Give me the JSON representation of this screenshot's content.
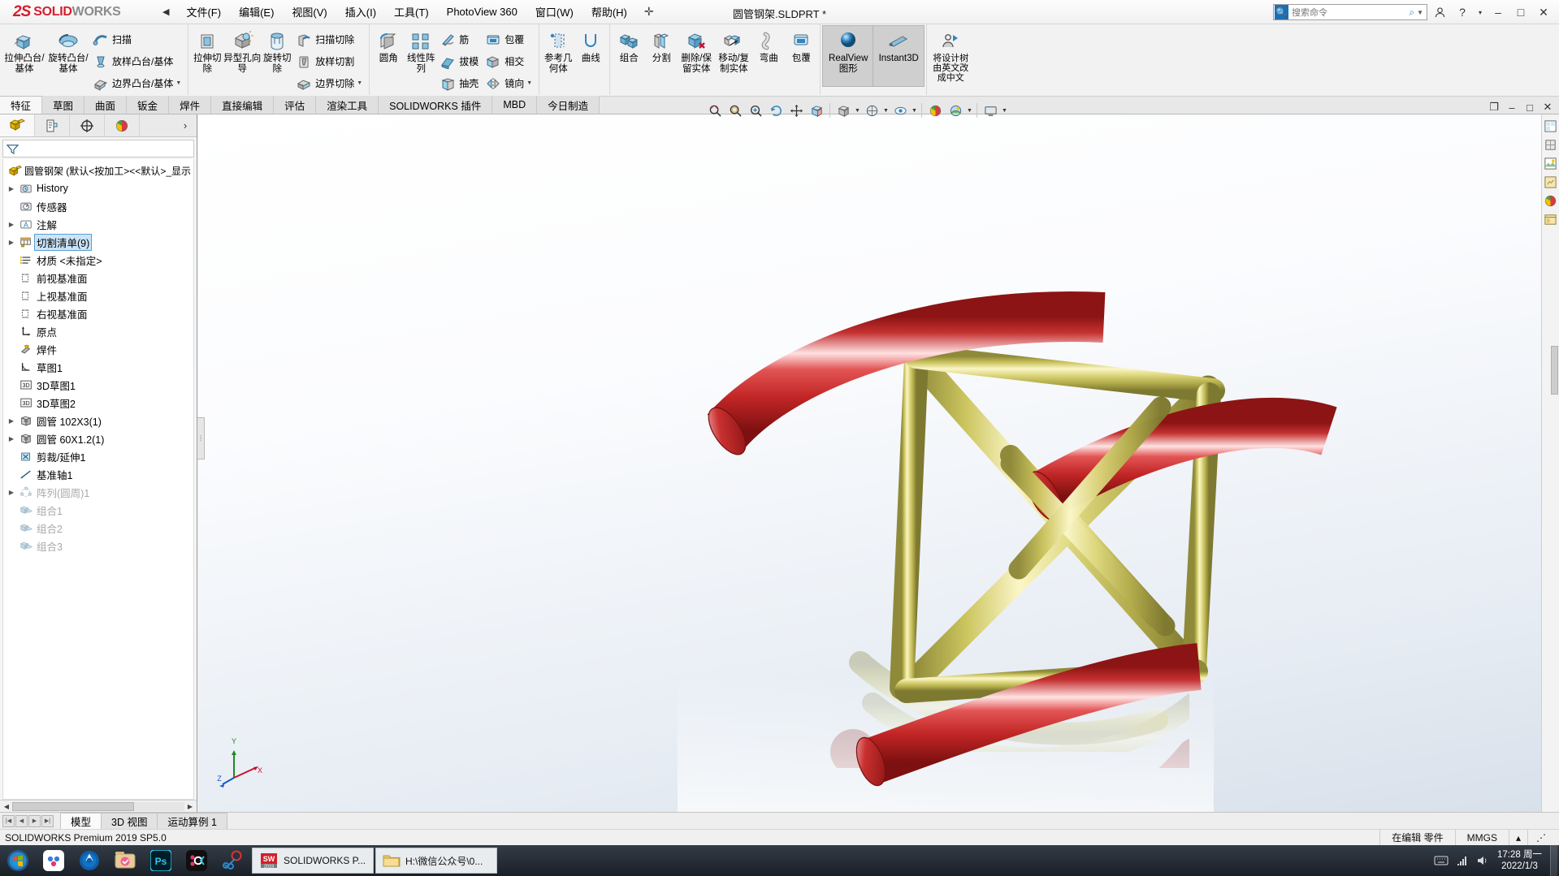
{
  "app": {
    "brand_ds": "2S",
    "brand_solid": "SOLID",
    "brand_works": "WORKS",
    "document_title": "圆管钢架.SLDPRT *",
    "accent_red": "#d61e2c",
    "selection_blue": "#cce4f7"
  },
  "menubar": {
    "items": [
      {
        "label": "文件(F)"
      },
      {
        "label": "编辑(E)"
      },
      {
        "label": "视图(V)"
      },
      {
        "label": "插入(I)"
      },
      {
        "label": "工具(T)"
      },
      {
        "label": "PhotoView 360"
      },
      {
        "label": "窗口(W)"
      },
      {
        "label": "帮助(H)"
      }
    ],
    "pin_icon": "pushpin-icon",
    "collapse_icon": "chevron-left-icon"
  },
  "search": {
    "placeholder": "搜索命令",
    "icon": "search-icon",
    "dropdown_icon": "chevron-down-icon"
  },
  "window_buttons": {
    "help": "?",
    "account": "user-icon",
    "minimize": "–",
    "maximize": "□",
    "close": "✕",
    "options_caret": "▾"
  },
  "ribbon": {
    "groups": [
      {
        "name": "features-boss",
        "big": [
          {
            "label": "拉伸凸台/基体",
            "icon": "extrude-boss-icon",
            "caret": true
          },
          {
            "label": "旋转凸台/基体",
            "icon": "revolve-boss-icon",
            "caret": true
          }
        ],
        "small": [
          {
            "label": "扫描",
            "icon": "sweep-icon"
          },
          {
            "label": "放样凸台/基体",
            "icon": "loft-icon"
          },
          {
            "label": "边界凸台/基体",
            "icon": "boundary-boss-icon"
          }
        ]
      },
      {
        "name": "features-cut",
        "big": [
          {
            "label": "拉伸切除",
            "icon": "extrude-cut-icon",
            "caret": true
          },
          {
            "label": "异型孔向导",
            "icon": "hole-wizard-icon",
            "caret": true
          },
          {
            "label": "旋转切除",
            "icon": "revolve-cut-icon"
          }
        ],
        "small": [
          {
            "label": "扫描切除",
            "icon": "sweep-cut-icon"
          },
          {
            "label": "放样切割",
            "icon": "loft-cut-icon"
          },
          {
            "label": "边界切除",
            "icon": "boundary-cut-icon"
          }
        ]
      },
      {
        "name": "features-modify",
        "big": [
          {
            "label": "圆角",
            "icon": "fillet-icon",
            "caret": true
          },
          {
            "label": "线性阵列",
            "icon": "linear-pattern-icon",
            "caret": true
          }
        ],
        "small": [
          {
            "label": "筋",
            "icon": "rib-icon"
          },
          {
            "label": "拔模",
            "icon": "draft-icon"
          },
          {
            "label": "抽壳",
            "icon": "shell-icon"
          }
        ],
        "small2": [
          {
            "label": "包覆",
            "icon": "wrap-icon"
          },
          {
            "label": "相交",
            "icon": "intersect-icon"
          },
          {
            "label": "镜向",
            "icon": "mirror-icon"
          }
        ]
      },
      {
        "name": "reference",
        "big": [
          {
            "label": "参考几何体",
            "icon": "reference-geometry-icon",
            "caret": true
          },
          {
            "label": "曲线",
            "icon": "curves-icon",
            "caret": true
          }
        ]
      },
      {
        "name": "bodies",
        "big": [
          {
            "label": "组合",
            "icon": "combine-icon"
          },
          {
            "label": "分割",
            "icon": "split-icon"
          },
          {
            "label": "删除/保留实体",
            "icon": "delete-keep-body-icon"
          },
          {
            "label": "移动/复制实体",
            "icon": "move-copy-body-icon"
          },
          {
            "label": "弯曲",
            "icon": "flex-icon"
          },
          {
            "label": "包覆",
            "icon": "wrap2-icon"
          }
        ]
      },
      {
        "name": "display",
        "big": [
          {
            "label": "RealView 图形",
            "icon": "realview-icon",
            "selected": true
          },
          {
            "label": "Instant3D",
            "icon": "instant3d-icon",
            "selected": true
          }
        ]
      },
      {
        "name": "translate",
        "big": [
          {
            "label": "将设计树由英文改成中文",
            "icon": "translate-tree-icon"
          }
        ]
      }
    ]
  },
  "command_tabs": {
    "items": [
      {
        "label": "特征",
        "active": true
      },
      {
        "label": "草图",
        "active": false
      },
      {
        "label": "曲面",
        "active": false
      },
      {
        "label": "钣金",
        "active": false
      },
      {
        "label": "焊件",
        "active": false
      },
      {
        "label": "直接编辑",
        "active": false
      },
      {
        "label": "评估",
        "active": false
      },
      {
        "label": "渲染工具",
        "active": false
      },
      {
        "label": "SOLIDWORKS 插件",
        "active": false
      },
      {
        "label": "MBD",
        "active": false
      },
      {
        "label": "今日制造",
        "active": false
      }
    ]
  },
  "view_toolbar": {
    "items": [
      {
        "icon": "zoom-to-fit-icon"
      },
      {
        "icon": "zoom-area-icon"
      },
      {
        "icon": "zoom-in-out-icon"
      },
      {
        "icon": "rotate-view-icon"
      },
      {
        "icon": "pan-icon"
      },
      {
        "icon": "section-view-icon"
      },
      {
        "icon": "view-orientation-icon",
        "caret": true
      },
      {
        "icon": "display-style-icon",
        "caret": true
      },
      {
        "icon": "hide-show-items-icon",
        "caret": true
      },
      {
        "icon": "edit-appearance-icon"
      },
      {
        "icon": "apply-scene-icon",
        "caret": true
      },
      {
        "icon": "view-settings-icon",
        "caret": true
      }
    ]
  },
  "doc_window_buttons": {
    "restore": "❐",
    "minimize": "–",
    "maximize": "□",
    "close": "✕"
  },
  "feature_manager": {
    "tabs": [
      {
        "name": "feature-manager-tab",
        "icon": "featuretree-icon",
        "active": true
      },
      {
        "name": "property-manager-tab",
        "icon": "property-manager-icon",
        "active": false
      },
      {
        "name": "configuration-manager-tab",
        "icon": "configuration-icon",
        "active": false
      },
      {
        "name": "display-manager-tab",
        "icon": "display-manager-icon",
        "active": false
      }
    ],
    "expand_icon": "chevron-right-icon",
    "filter_icon": "filter-icon",
    "filter_placeholder": "",
    "root": {
      "label": "圆管钢架  (默认<按加工><<默认>_显示",
      "icon": "part-icon"
    },
    "tree": [
      {
        "label": "History",
        "icon": "history-icon",
        "expandable": true,
        "indent": 1
      },
      {
        "label": "传感器",
        "icon": "sensors-icon",
        "expandable": false,
        "indent": 1
      },
      {
        "label": "注解",
        "icon": "annotations-icon",
        "expandable": true,
        "indent": 1
      },
      {
        "label": "切割清单(9)",
        "icon": "cutlist-icon",
        "expandable": true,
        "indent": 1,
        "selected": true
      },
      {
        "label": "材质 <未指定>",
        "icon": "material-icon",
        "expandable": false,
        "indent": 1
      },
      {
        "label": "前视基准面",
        "icon": "plane-icon",
        "expandable": false,
        "indent": 1
      },
      {
        "label": "上视基准面",
        "icon": "plane-icon",
        "expandable": false,
        "indent": 1
      },
      {
        "label": "右视基准面",
        "icon": "plane-icon",
        "expandable": false,
        "indent": 1
      },
      {
        "label": "原点",
        "icon": "origin-icon",
        "expandable": false,
        "indent": 1
      },
      {
        "label": "焊件",
        "icon": "weldment-icon",
        "expandable": false,
        "indent": 1
      },
      {
        "label": "草图1",
        "icon": "sketch-icon",
        "expandable": false,
        "indent": 1
      },
      {
        "label": "3D草图1",
        "icon": "sketch3d-icon",
        "expandable": false,
        "indent": 1
      },
      {
        "label": "3D草图2",
        "icon": "sketch3d-icon",
        "expandable": false,
        "indent": 1
      },
      {
        "label": "圆管 102X3(1)",
        "icon": "structural-member-icon",
        "expandable": true,
        "indent": 1
      },
      {
        "label": "圆管 60X1.2(1)",
        "icon": "structural-member-icon",
        "expandable": true,
        "indent": 1
      },
      {
        "label": "剪裁/延伸1",
        "icon": "trim-extend-icon",
        "expandable": false,
        "indent": 1
      },
      {
        "label": "基准轴1",
        "icon": "axis-icon",
        "expandable": false,
        "indent": 1
      },
      {
        "label": "阵列(圆周)1",
        "icon": "circular-pattern-icon",
        "expandable": true,
        "indent": 1,
        "dim": true
      },
      {
        "label": "组合1",
        "icon": "combine-tree-icon",
        "expandable": false,
        "indent": 1,
        "dim": true
      },
      {
        "label": "组合2",
        "icon": "combine-tree-icon",
        "expandable": false,
        "indent": 1,
        "dim": true
      },
      {
        "label": "组合3",
        "icon": "combine-tree-icon",
        "expandable": false,
        "indent": 1,
        "dim": true
      }
    ]
  },
  "graphics": {
    "triad_labels": {
      "x": "X",
      "y": "Y",
      "z": "Z"
    },
    "model_description": "圆管钢架 tubular steel frame - red 102X3 tubes and yellow 60X1.2 braces with reflection"
  },
  "right_rail": {
    "items": [
      {
        "icon": "view-palette-icon"
      },
      {
        "icon": "appearances-icon"
      },
      {
        "icon": "scenes-icon"
      },
      {
        "icon": "decals-icon"
      },
      {
        "icon": "custom-properties-icon"
      },
      {
        "icon": "design-library-icon"
      }
    ]
  },
  "bottom_tabs": {
    "nav": [
      "|◀",
      "◀",
      "▶",
      "▶|"
    ],
    "items": [
      {
        "label": "模型",
        "active": true
      },
      {
        "label": "3D 视图",
        "active": false
      },
      {
        "label": "运动算例 1",
        "active": false
      }
    ]
  },
  "status_bar": {
    "left": "SOLIDWORKS Premium 2019 SP5.0",
    "editing": "在编辑 零件",
    "units": "MMGS",
    "units_caret": "▴"
  },
  "taskbar": {
    "start_icon": "windows-start-icon",
    "pinned": [
      {
        "icon": "app-360-icon",
        "name": "cloud-app"
      },
      {
        "icon": "browser-icon",
        "name": "browser-app"
      },
      {
        "icon": "folder-photo-icon",
        "name": "photo-manager-app"
      },
      {
        "icon": "photoshop-icon",
        "name": "photoshop-app",
        "label": "Ps"
      },
      {
        "icon": "obs-icon",
        "name": "capture-app"
      },
      {
        "icon": "snip-icon",
        "name": "snipping-tool-app"
      }
    ],
    "windows": [
      {
        "label": "SOLIDWORKS P...",
        "icon": "solidworks-icon",
        "badge": "2019"
      },
      {
        "label": "H:\\微信公众号\\0...",
        "icon": "folder-icon"
      }
    ],
    "tray_icons": [
      "keyboard-icon",
      "network-icon",
      "volume-icon",
      "arrow-up-icon"
    ],
    "clock_time": "17:28 周一",
    "clock_date": "2022/1/3"
  }
}
